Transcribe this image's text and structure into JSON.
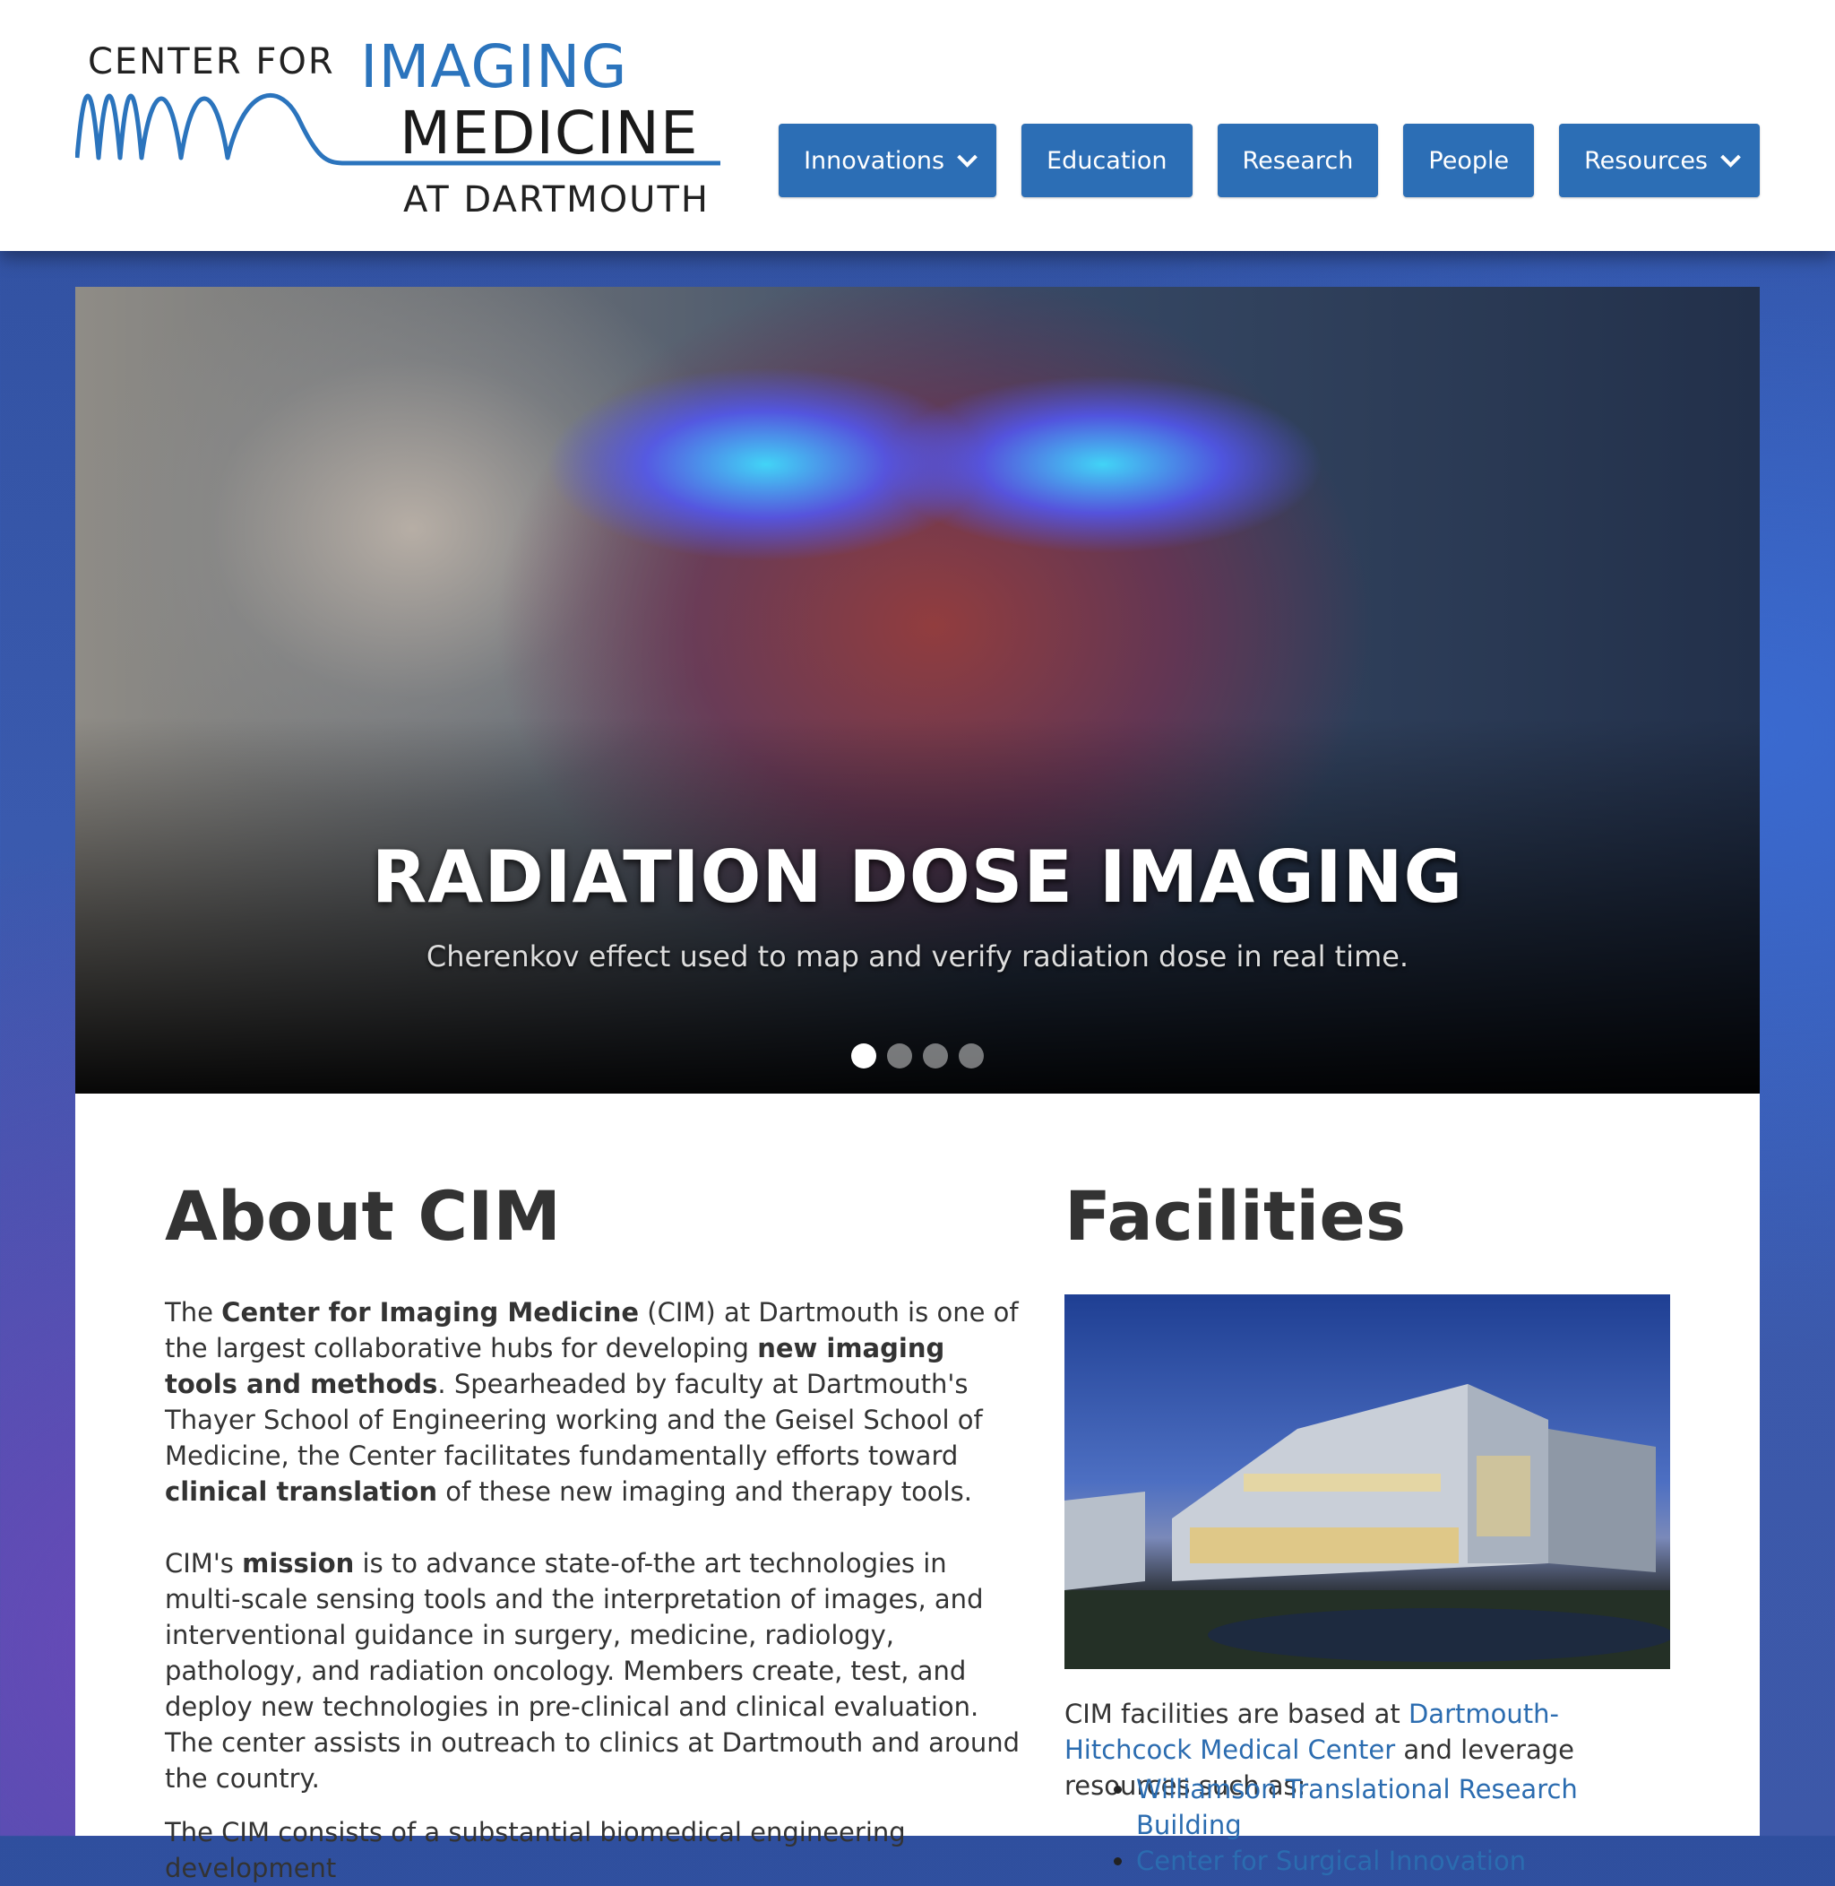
{
  "logo": {
    "line1": "CENTER FOR",
    "line2": "IMAGING",
    "line3": "MEDICINE",
    "line4": "AT DARTMOUTH"
  },
  "nav": {
    "items": [
      {
        "label": "Innovations",
        "dropdown": true
      },
      {
        "label": "Education",
        "dropdown": false
      },
      {
        "label": "Research",
        "dropdown": false
      },
      {
        "label": "People",
        "dropdown": false
      },
      {
        "label": "Resources",
        "dropdown": true
      }
    ]
  },
  "hero": {
    "title": "RADIATION DOSE IMAGING",
    "subtitle": "Cherenkov effect used to map and verify radiation dose in real time.",
    "slide_count": 4,
    "active_slide": 1
  },
  "about": {
    "heading": "About CIM",
    "p1": {
      "t1": "The ",
      "b1": "Center for Imaging Medicine",
      "t2": " (CIM) at Dartmouth is one of the largest collaborative hubs for developing ",
      "b2": "new imaging tools and methods",
      "t3": ". Spearheaded by faculty at Dartmouth's Thayer School of Engineering working and the Geisel School of Medicine, the Center facilitates fundamentally efforts toward ",
      "b3": "clinical translation",
      "t4": " of these new imaging and therapy tools."
    },
    "p2": {
      "t1": "CIM's ",
      "b1": "mission",
      "t2": " is to advance state-of-the art technologies in multi-scale sensing tools and the interpretation of images, and interventional guidance in surgery, medicine, radiology, pathology, and radiation oncology. Members create, test, and deploy new technologies in pre-clinical and clinical evaluation.  The center assists in outreach to clinics at Dartmouth and around the country."
    },
    "p3": "The CIM consists of a substantial biomedical engineering development"
  },
  "facilities": {
    "heading": "Facilities",
    "text_before": "CIM facilities are based at ",
    "link": "Dartmouth-Hitchcock Medical Center",
    "text_after": " and leverage resources such as:",
    "list": [
      "Williamson Translational Research Building",
      "Center for Surgical Innovation"
    ]
  },
  "colors": {
    "brand_blue": "#2c6eb5",
    "link_blue": "#2b6cb0",
    "text": "#333333"
  }
}
